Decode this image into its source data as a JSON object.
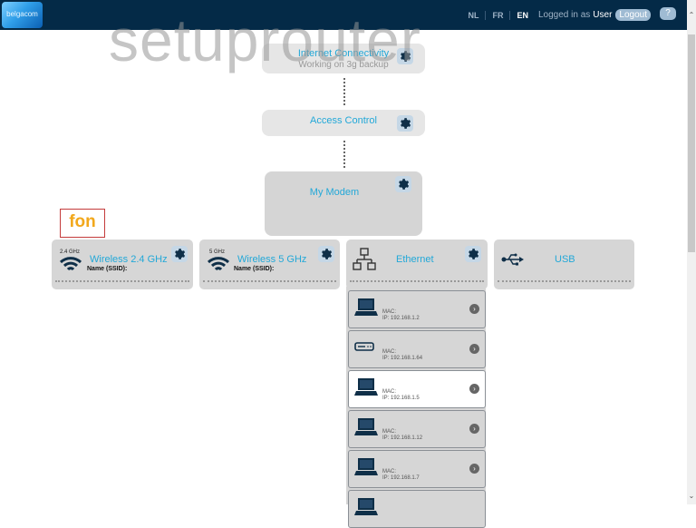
{
  "header": {
    "logo_text": "belgacom",
    "languages": [
      "NL",
      "FR",
      "EN"
    ],
    "active_language": "EN",
    "logged_in_label": "Logged in as",
    "user_name": "User",
    "logout_label": "Logout",
    "help_label": "?"
  },
  "watermark": "setuprouter",
  "nodes": {
    "internet": {
      "title": "Internet Connectivity",
      "status": "Working on 3g backup"
    },
    "access_control": {
      "title": "Access Control"
    },
    "modem": {
      "title": "My Modem"
    }
  },
  "fon_label": "fon",
  "interfaces": [
    {
      "title": "Wireless 2.4 GHz",
      "band": "2.4 GHz",
      "ssid_label": "Name (SSID):",
      "icon": "wifi-icon"
    },
    {
      "title": "Wireless 5 GHz",
      "band": "5 GHz",
      "ssid_label": "Name (SSID):",
      "icon": "wifi-icon"
    },
    {
      "title": "Ethernet",
      "icon": "network-icon"
    },
    {
      "title": "USB",
      "icon": "usb-icon"
    }
  ],
  "devices": [
    {
      "type": "laptop",
      "mac_label": "MAC:",
      "ip": "IP: 192.168.1.2"
    },
    {
      "type": "set-top-box",
      "mac_label": "MAC:",
      "ip": "IP: 192.168.1.64"
    },
    {
      "type": "laptop",
      "mac_label": "MAC:",
      "ip": "IP: 192.168.1.5",
      "selected": true
    },
    {
      "type": "laptop",
      "mac_label": "MAC:",
      "ip": "IP: 192.168.1.12"
    },
    {
      "type": "laptop",
      "mac_label": "MAC:",
      "ip": "IP: 192.168.1.7"
    },
    {
      "type": "laptop",
      "mac_label": "",
      "ip": ""
    }
  ]
}
